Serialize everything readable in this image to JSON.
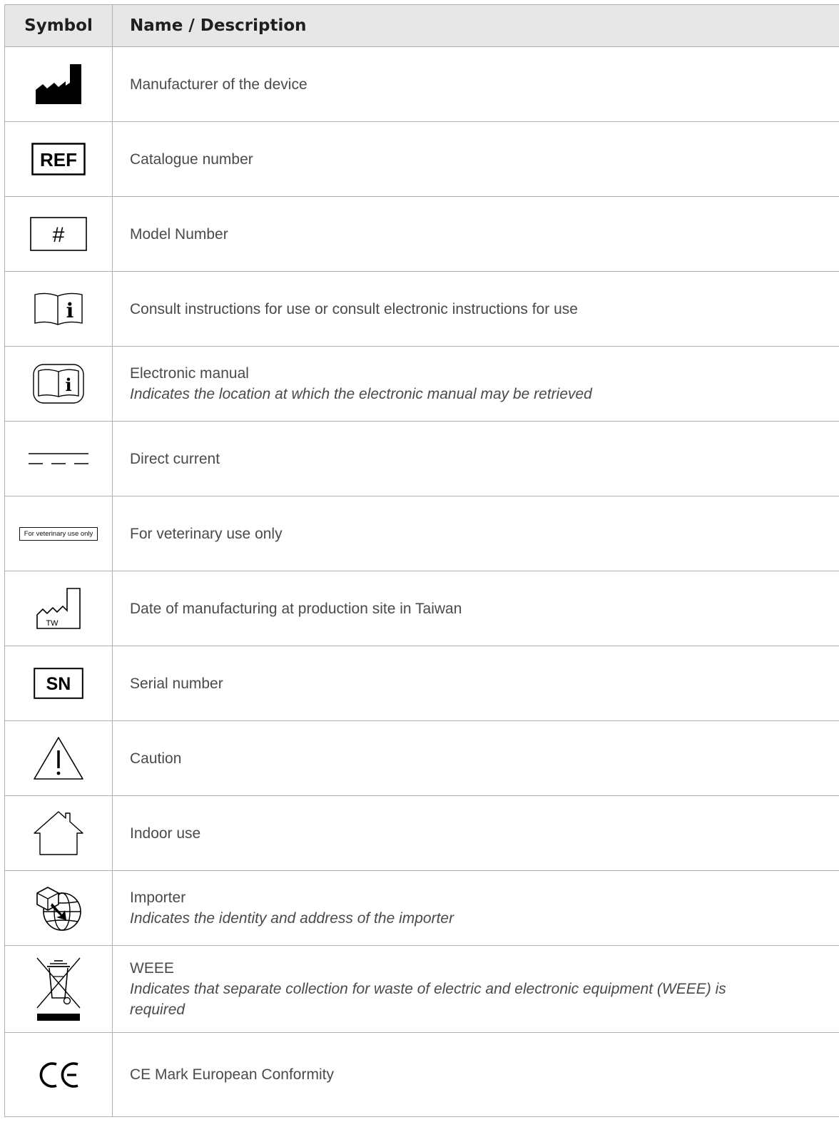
{
  "header": {
    "symbol": "Symbol",
    "name": "Name / Description"
  },
  "rows": [
    {
      "icon": "manufacturer-icon",
      "name": "Manufacturer of the device",
      "desc": ""
    },
    {
      "icon": "ref-icon",
      "icon_text": "REF",
      "name": "Catalogue number",
      "desc": ""
    },
    {
      "icon": "model-number-icon",
      "icon_text": "#",
      "name": "Model Number",
      "desc": ""
    },
    {
      "icon": "consult-instructions-icon",
      "name": "Consult instructions for use or consult electronic instructions for use",
      "desc": ""
    },
    {
      "icon": "electronic-manual-icon",
      "name": "Electronic manual",
      "desc": "Indicates the location at which the electronic manual may be retrieved"
    },
    {
      "icon": "direct-current-icon",
      "name": "Direct current",
      "desc": ""
    },
    {
      "icon": "veterinary-label-icon",
      "icon_text": "For veterinary use only",
      "name": "For veterinary use only",
      "desc": ""
    },
    {
      "icon": "date-of-manufacture-icon",
      "icon_text": "TW",
      "name": "Date of manufacturing at production site in Taiwan",
      "desc": ""
    },
    {
      "icon": "serial-number-icon",
      "icon_text": "SN",
      "name": "Serial number",
      "desc": ""
    },
    {
      "icon": "caution-icon",
      "name": "Caution",
      "desc": ""
    },
    {
      "icon": "indoor-use-icon",
      "name": "Indoor use",
      "desc": ""
    },
    {
      "icon": "importer-icon",
      "name": "Importer",
      "desc": "Indicates the identity and address of the importer"
    },
    {
      "icon": "weee-icon",
      "name": "WEEE",
      "desc": "Indicates that separate collection for waste of electric and electronic equipment (WEEE) is required"
    },
    {
      "icon": "ce-mark-icon",
      "name": "CE Mark European Conformity",
      "desc": ""
    }
  ]
}
